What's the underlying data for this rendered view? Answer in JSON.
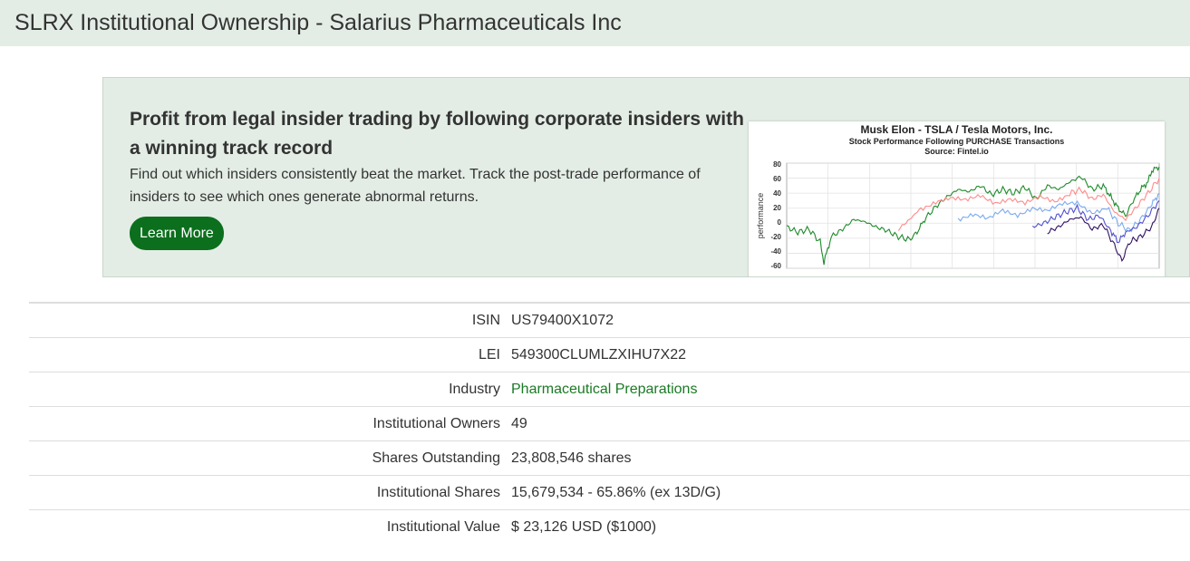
{
  "page": {
    "title": "SLRX Institutional Ownership - Salarius Pharmaceuticals Inc"
  },
  "promo": {
    "heading": "Profit from legal insider trading by following corporate insiders with a winning track record",
    "text": "Find out which insiders consistently beat the market. Track the post-trade performance of insiders to see which ones generate abnormal returns.",
    "button_label": "Learn More",
    "button_color": "#0b6f1d",
    "chart": {
      "title": "Musk Elon - TSLA / Tesla Motors, Inc.",
      "subtitle": "Stock Performance Following PURCHASE Transactions",
      "source": "Source: Fintel.io",
      "ylabel": "performance",
      "y_ticks": [
        "80",
        "60",
        "40",
        "20",
        "0",
        "-20",
        "-40",
        "-60"
      ]
    }
  },
  "chart_data": {
    "type": "line",
    "title": "Musk Elon - TSLA / Tesla Motors, Inc.",
    "subtitle": "Stock Performance Following PURCHASE Transactions",
    "source": "Source: Fintel.io",
    "ylabel": "performance",
    "ylim": [
      -60,
      80
    ],
    "x_domain": [
      0,
      100
    ],
    "grid": true,
    "series": [
      {
        "color": "#1e8a2a",
        "start": 0,
        "points": [
          [
            0,
            -5
          ],
          [
            3,
            -12
          ],
          [
            6,
            -8
          ],
          [
            9,
            -25
          ],
          [
            10,
            -52
          ],
          [
            12,
            -18
          ],
          [
            15,
            -8
          ],
          [
            18,
            5
          ],
          [
            21,
            2
          ],
          [
            24,
            -5
          ],
          [
            27,
            -10
          ],
          [
            30,
            -18
          ],
          [
            33,
            -22
          ],
          [
            35,
            -12
          ],
          [
            37,
            5
          ],
          [
            40,
            22
          ],
          [
            43,
            35
          ],
          [
            46,
            45
          ],
          [
            49,
            42
          ],
          [
            52,
            50
          ],
          [
            55,
            38
          ],
          [
            58,
            45
          ],
          [
            61,
            40
          ],
          [
            64,
            48
          ],
          [
            67,
            32
          ],
          [
            70,
            50
          ],
          [
            73,
            45
          ],
          [
            76,
            55
          ],
          [
            79,
            62
          ],
          [
            82,
            45
          ],
          [
            85,
            50
          ],
          [
            87,
            35
          ],
          [
            89,
            20
          ],
          [
            91,
            10
          ],
          [
            93,
            30
          ],
          [
            95,
            45
          ],
          [
            97,
            55
          ],
          [
            98,
            70
          ],
          [
            100,
            75
          ]
        ]
      },
      {
        "color": "#ff8a8a",
        "start": 30,
        "points": [
          [
            30,
            -8
          ],
          [
            33,
            5
          ],
          [
            36,
            20
          ],
          [
            40,
            28
          ],
          [
            44,
            32
          ],
          [
            48,
            30
          ],
          [
            52,
            38
          ],
          [
            56,
            28
          ],
          [
            60,
            32
          ],
          [
            64,
            25
          ],
          [
            68,
            35
          ],
          [
            72,
            30
          ],
          [
            76,
            40
          ],
          [
            79,
            45
          ],
          [
            82,
            32
          ],
          [
            85,
            38
          ],
          [
            88,
            15
          ],
          [
            91,
            5
          ],
          [
            94,
            22
          ],
          [
            97,
            40
          ],
          [
            100,
            60
          ]
        ]
      },
      {
        "color": "#7aaaf0",
        "start": 46,
        "points": [
          [
            46,
            5
          ],
          [
            50,
            10
          ],
          [
            54,
            5
          ],
          [
            58,
            18
          ],
          [
            62,
            12
          ],
          [
            66,
            20
          ],
          [
            70,
            15
          ],
          [
            74,
            25
          ],
          [
            78,
            28
          ],
          [
            82,
            15
          ],
          [
            86,
            20
          ],
          [
            89,
            0
          ],
          [
            92,
            -10
          ],
          [
            95,
            5
          ],
          [
            98,
            25
          ],
          [
            100,
            40
          ]
        ]
      },
      {
        "color": "#5050d0",
        "start": 66,
        "points": [
          [
            66,
            -5
          ],
          [
            69,
            0
          ],
          [
            72,
            8
          ],
          [
            75,
            15
          ],
          [
            78,
            20
          ],
          [
            81,
            5
          ],
          [
            84,
            10
          ],
          [
            87,
            -10
          ],
          [
            89,
            -25
          ],
          [
            91,
            -12
          ],
          [
            94,
            -5
          ],
          [
            97,
            10
          ],
          [
            100,
            30
          ]
        ]
      },
      {
        "color": "#301060",
        "start": 70,
        "points": [
          [
            70,
            -12
          ],
          [
            73,
            -5
          ],
          [
            76,
            5
          ],
          [
            79,
            8
          ],
          [
            82,
            -8
          ],
          [
            85,
            -2
          ],
          [
            88,
            -30
          ],
          [
            90,
            -50
          ],
          [
            92,
            -25
          ],
          [
            95,
            -18
          ],
          [
            98,
            -5
          ],
          [
            100,
            20
          ]
        ]
      }
    ]
  },
  "details": [
    {
      "label": "ISIN",
      "value": "US79400X1072",
      "is_link": false
    },
    {
      "label": "LEI",
      "value": "549300CLUMLZXIHU7X22",
      "is_link": false
    },
    {
      "label": "Industry",
      "value": "Pharmaceutical Preparations",
      "is_link": true
    },
    {
      "label": "Institutional Owners",
      "value": "49",
      "is_link": false
    },
    {
      "label": "Shares Outstanding",
      "value": "23,808,546 shares",
      "is_link": false
    },
    {
      "label": "Institutional Shares",
      "value": "15,679,534 - 65.86% (ex 13D/G)",
      "is_link": false
    },
    {
      "label": "Institutional Value",
      "value": "$ 23,126 USD ($1000)",
      "is_link": false
    }
  ],
  "colors": {
    "title_bar_bg": "#e3ede5",
    "link": "#1a7a24"
  }
}
